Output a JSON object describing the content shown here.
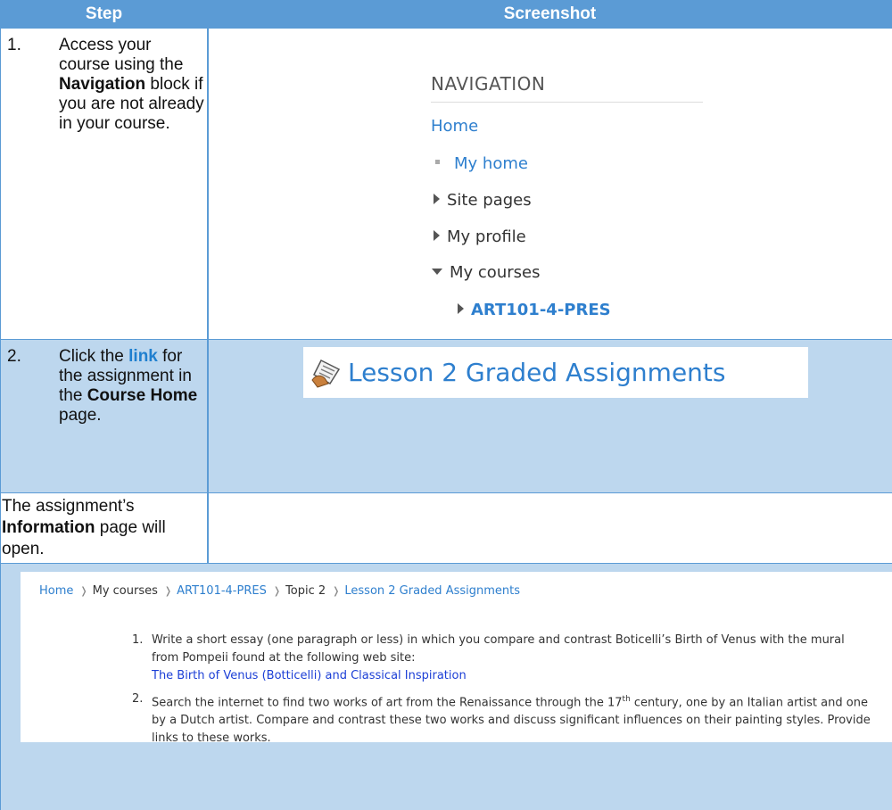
{
  "header": {
    "step": "Step",
    "screenshot": "Screenshot"
  },
  "rows": [
    {
      "num": "1.",
      "parts": [
        "Access your course using the ",
        "Navigation",
        " block if you are not already in your course."
      ]
    },
    {
      "num": "2.",
      "parts": [
        "Click the ",
        "link",
        " for the assignment in the ",
        "Course Home",
        " page."
      ]
    },
    {
      "parts": [
        "The assignment’s ",
        "Information",
        " page will open."
      ]
    }
  ],
  "navigation": {
    "title": "NAVIGATION",
    "items": [
      "Home",
      "My home",
      "Site pages",
      "My profile",
      "My courses",
      "ART101-4-PRES"
    ]
  },
  "lesson_link": "Lesson 2 Graded Assignments",
  "breadcrumb": [
    "Home",
    "My courses",
    "ART101-4-PRES",
    "Topic 2",
    "Lesson 2 Graded Assignments"
  ],
  "assignment": {
    "items": [
      {
        "num": "1.",
        "text": "Write a short essay (one paragraph or less) in which you compare and contrast Boticelli’s Birth of Venus with the mural from Pompeii found at the following web site:",
        "link": "The Birth of Venus (Botticelli) and Classical Inspiration"
      },
      {
        "num": "2.",
        "text_a": "Search the internet to find two works of art from the Renaissance through the 17",
        "sup": "th",
        "text_b": " century, one by an Italian artist and one by a Dutch artist. Compare and contrast these two works and discuss significant influences on their painting styles. Provide links to these works."
      }
    ]
  },
  "colors": {
    "header_bg": "#5b9bd5",
    "row_highlight": "#bdd7ee",
    "link_blue": "#2e7fce"
  }
}
